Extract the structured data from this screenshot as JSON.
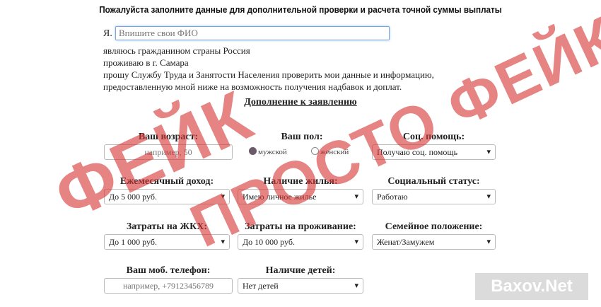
{
  "header": {
    "title": "Пожалуйста заполните данные для дополнительной проверки и расчета точной суммы выплаты"
  },
  "intro": {
    "ya_label": "Я.",
    "name_placeholder": "Впишите свои ФИО",
    "citizen_text": "являюсь гражданином страны",
    "country": "Россия",
    "residence_text": "проживаю в г.",
    "city": "Самара",
    "request_line1": "прошу Службу Труда и Занятости Населения проверить мои данные и информацию,",
    "request_line2": "предоставленную мной ниже на возможность получения надбавок и доплат."
  },
  "section_title": "Дополнение к заявлению",
  "form": {
    "age": {
      "label": "Ваш возраст:",
      "placeholder": "например, 50"
    },
    "gender": {
      "label": "Ваш пол:",
      "options": [
        "мужской",
        "женский"
      ],
      "selected": "мужской"
    },
    "social_help": {
      "label": "Соц. помощь:",
      "value": "Получаю соц. помощь"
    },
    "monthly_income": {
      "label": "Ежемесячный доход:",
      "value": "До 5 000 руб."
    },
    "housing": {
      "label": "Наличие жилья:",
      "value": "Имею личное жилье"
    },
    "social_status": {
      "label": "Социальный статус:",
      "value": "Работаю"
    },
    "utility_costs": {
      "label": "Затраты на ЖКХ:",
      "value": "До 1 000 руб."
    },
    "living_costs": {
      "label": "Затраты на проживание:",
      "value": "До 10 000 руб."
    },
    "family_status": {
      "label": "Семейное положение:",
      "value": "Женат/Замужем"
    },
    "phone": {
      "label": "Ваш моб. телефон:",
      "placeholder": "например, +79123456789"
    },
    "children": {
      "label": "Наличие детей:",
      "value": "Нет детей"
    }
  },
  "overlay": {
    "stamp_line1": "ФЕЙК",
    "stamp_line2": "ПРОСТО ФЕЙК",
    "watermark": "Baxov.Net",
    "stamp_color": "#d73737"
  }
}
